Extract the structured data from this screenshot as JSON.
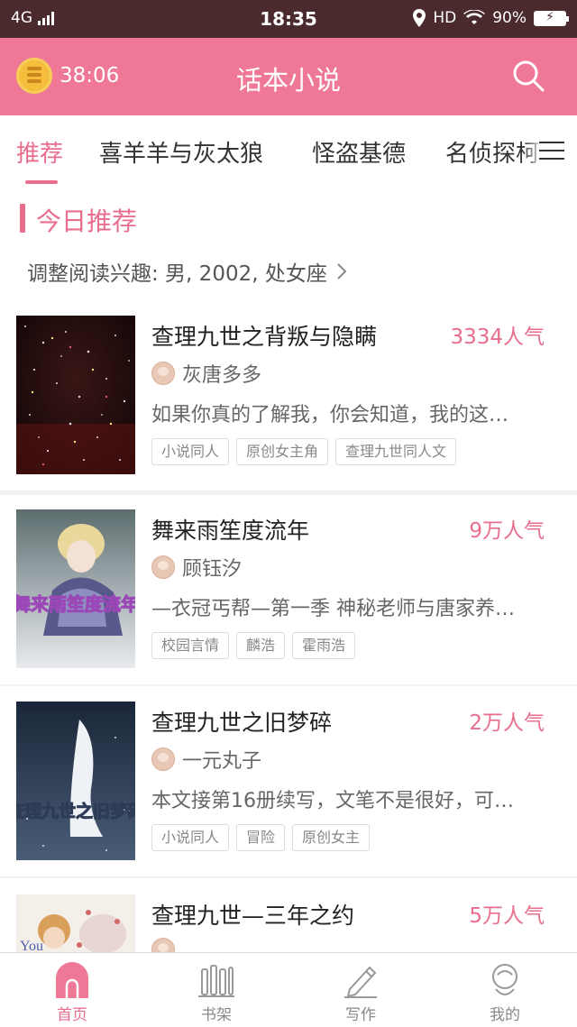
{
  "status_bar": {
    "network": "4G",
    "time": "18:35",
    "hd": "HD",
    "battery": "90%"
  },
  "header": {
    "timer": "38:06",
    "title": "话本小说",
    "search_icon": "search-icon"
  },
  "tabs": [
    {
      "label": "推荐",
      "active": true
    },
    {
      "label": "喜羊羊与灰太狼",
      "active": false
    },
    {
      "label": "怪盗基德",
      "active": false
    },
    {
      "label": "名侦探柯",
      "active": false
    }
  ],
  "section": {
    "heading": "今日推荐",
    "interest": "调整阅读兴趣: 男, 2002, 处女座"
  },
  "books": [
    {
      "name": "查理九世之背叛与隐瞒",
      "popularity": "3334人气",
      "author": "灰唐多多",
      "desc": "如果你真的了解我，你会知道，我的这…",
      "tags": [
        "小说同人",
        "原创女主角",
        "查理九世同人文"
      ]
    },
    {
      "name": "舞来雨笙度流年",
      "popularity": "9万人气",
      "author": "顾钰汐",
      "desc": "—衣冠丐帮—第一季 神秘老师与唐家养…",
      "tags": [
        "校园言情",
        "麟浩",
        "霍雨浩"
      ],
      "cover_text": "舞来雨笙度流年"
    },
    {
      "name": "查理九世之旧梦碎",
      "popularity": "2万人气",
      "author": "一元丸子",
      "desc": "本文接第16册续写，文笔不是很好，可…",
      "tags": [
        "小说同人",
        "冒险",
        "原创女主"
      ],
      "cover_text": "查理九世之旧梦碎"
    },
    {
      "name": "查理九世—三年之约",
      "popularity": "5万人气",
      "author": "",
      "desc": "",
      "tags": []
    }
  ],
  "bottom_nav": [
    {
      "label": "首页",
      "icon": "home-icon",
      "active": true
    },
    {
      "label": "书架",
      "icon": "bookshelf-icon",
      "active": false
    },
    {
      "label": "写作",
      "icon": "pencil-icon",
      "active": false
    },
    {
      "label": "我的",
      "icon": "profile-icon",
      "active": false
    }
  ],
  "colors": {
    "accent": "#e96e8d",
    "header_bg": "#ef7896",
    "status_bg": "#4a2a2d"
  }
}
